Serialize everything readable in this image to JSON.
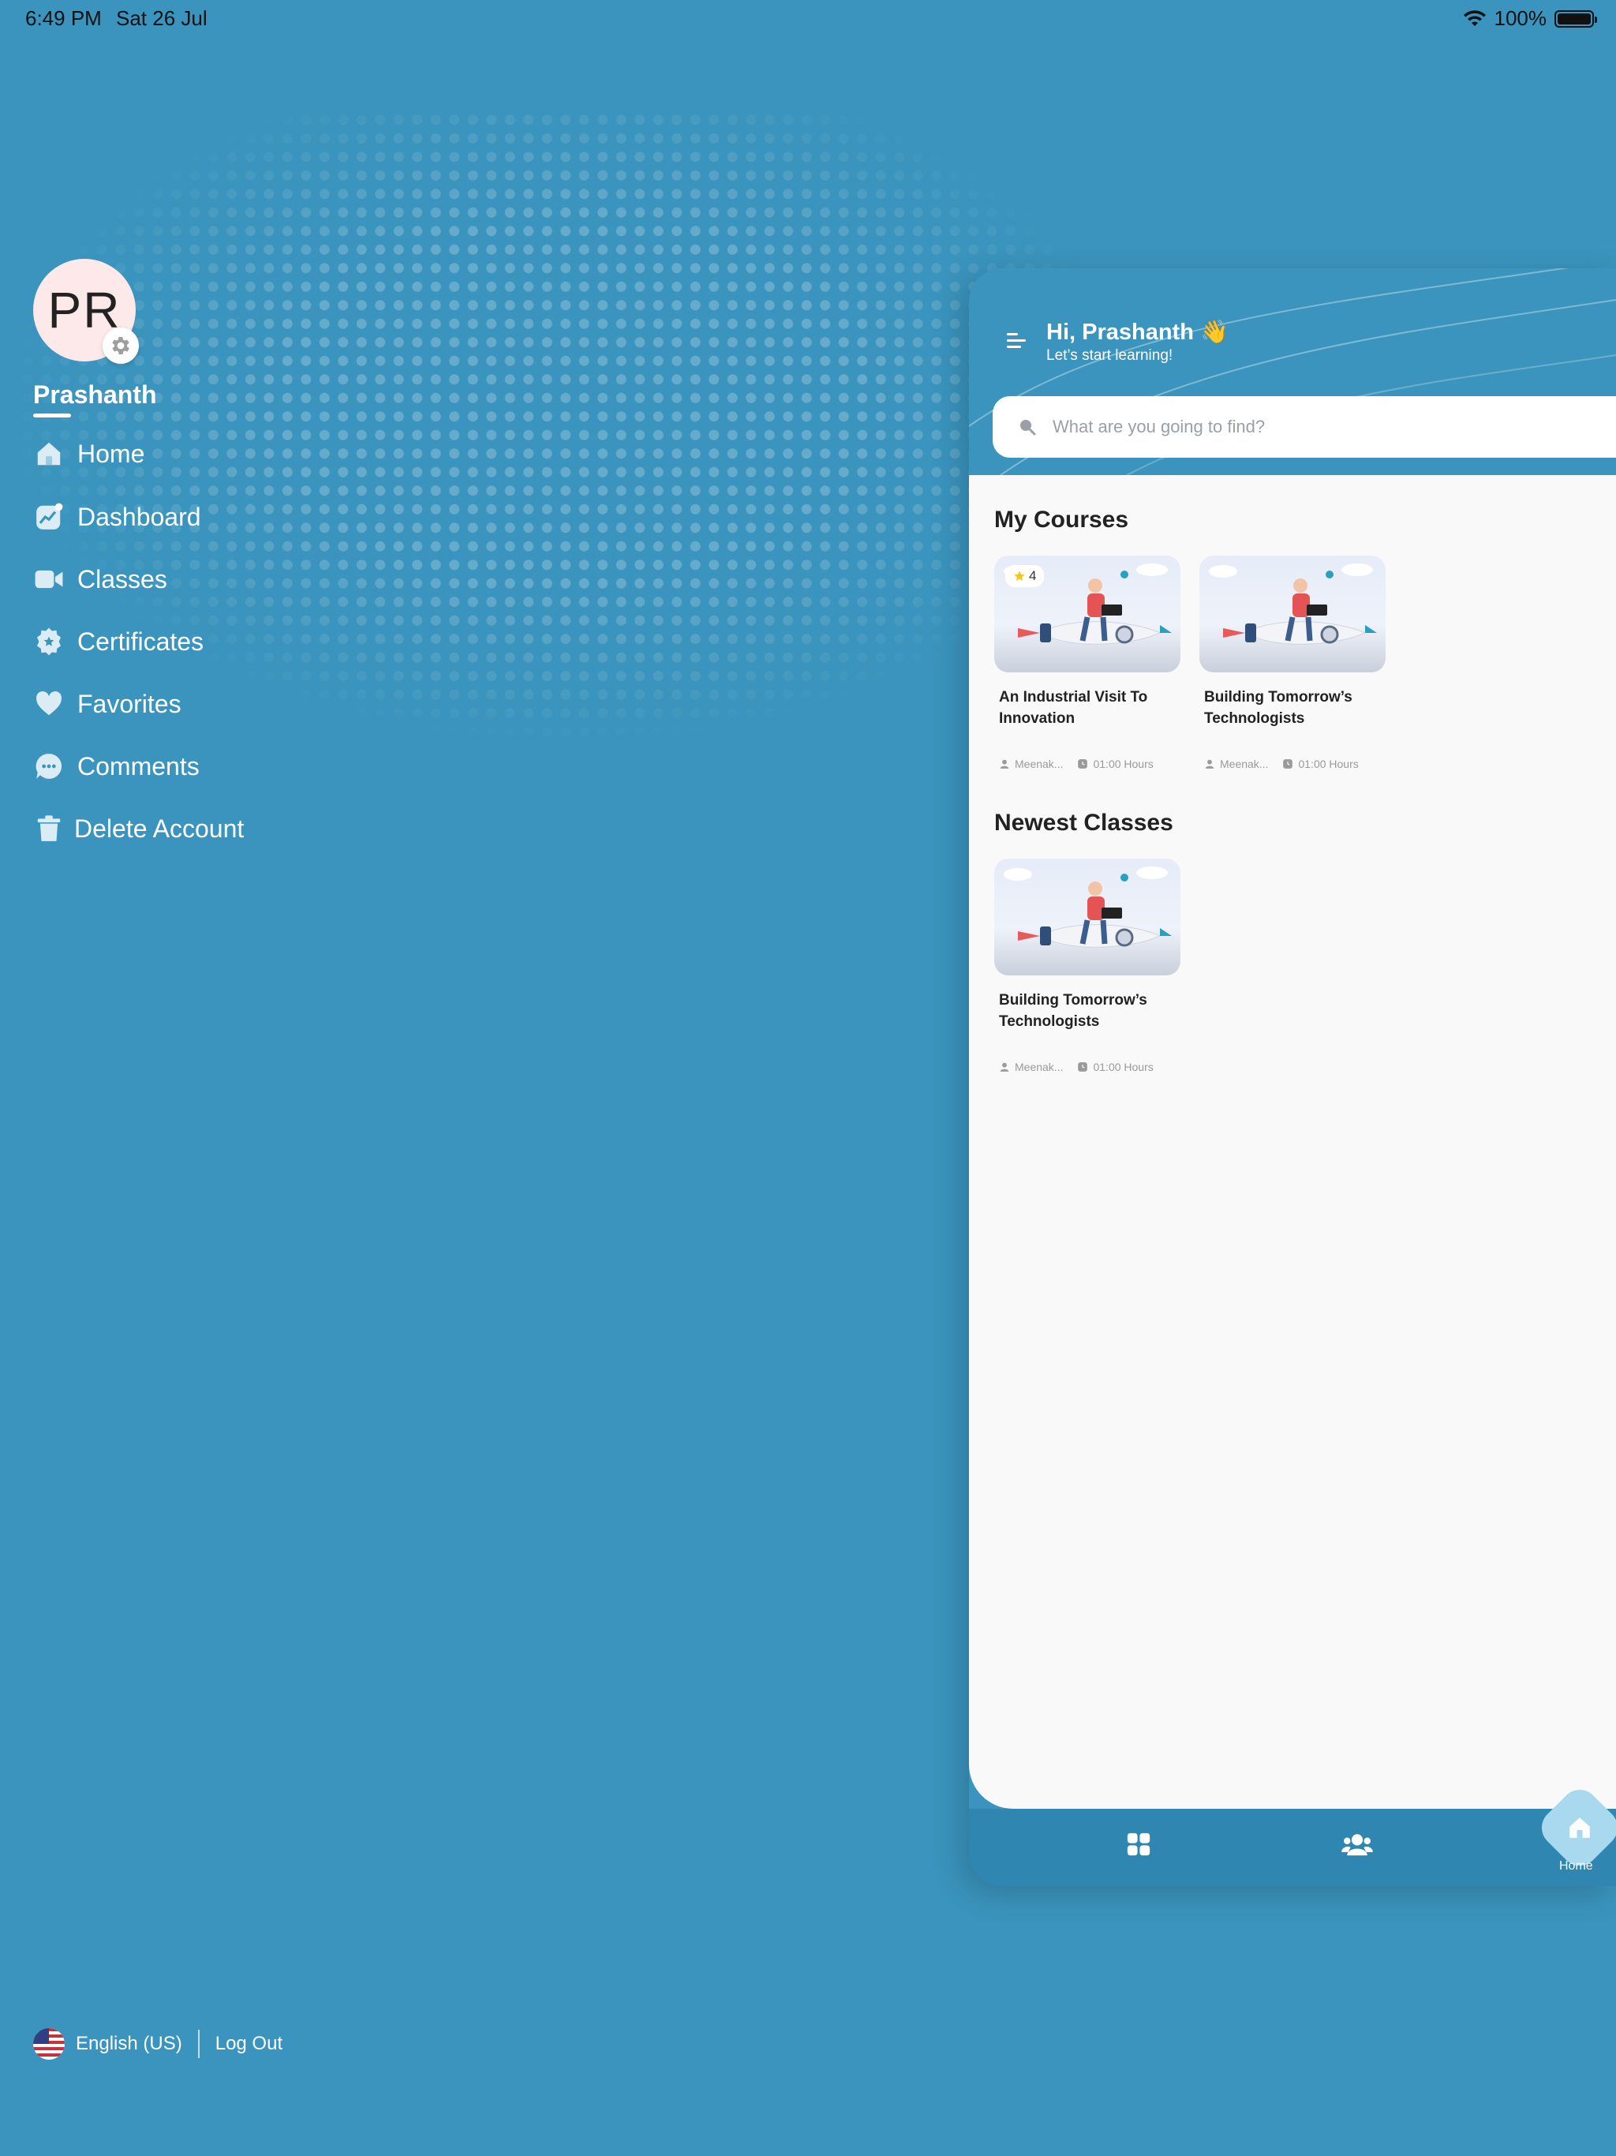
{
  "status_bar": {
    "time": "6:49 PM",
    "date": "Sat 26 Jul",
    "battery": "100%"
  },
  "profile": {
    "initials": "PR",
    "name": "Prashanth"
  },
  "menu": [
    {
      "label": "Home",
      "icon": "home-icon"
    },
    {
      "label": "Dashboard",
      "icon": "dashboard-icon"
    },
    {
      "label": "Classes",
      "icon": "video-icon"
    },
    {
      "label": "Certificates",
      "icon": "certificate-icon"
    },
    {
      "label": "Favorites",
      "icon": "heart-icon"
    },
    {
      "label": "Comments",
      "icon": "comment-icon"
    },
    {
      "label": "Delete Account",
      "icon": "trash-icon"
    }
  ],
  "footer": {
    "language": "English (US)",
    "logout": "Log Out"
  },
  "app": {
    "greeting": "Hi, Prashanth",
    "greeting_emoji": "👋",
    "subtitle": "Let’s start learning!",
    "search_placeholder": "What are you going to find?",
    "my_courses_title": "My Courses",
    "my_courses": [
      {
        "title": "An Industrial Visit To Innovation",
        "rating": "4",
        "instructor": "Meenak...",
        "duration": "01:00 Hours"
      },
      {
        "title": "Building Tomorrow’s Technologists",
        "instructor": "Meenak...",
        "duration": "01:00 Hours"
      }
    ],
    "newest_title": "Newest Classes",
    "newest_classes": [
      {
        "title": "Building Tomorrow’s Technologists",
        "instructor": "Meenak...",
        "duration": "01:00 Hours"
      }
    ],
    "tabbar": {
      "home_label": "Home"
    }
  },
  "colors": {
    "background": "#3a94bd",
    "panel": "#f9f9f9",
    "tabbar": "#2f86b0",
    "fab": "#a8d9ee"
  }
}
